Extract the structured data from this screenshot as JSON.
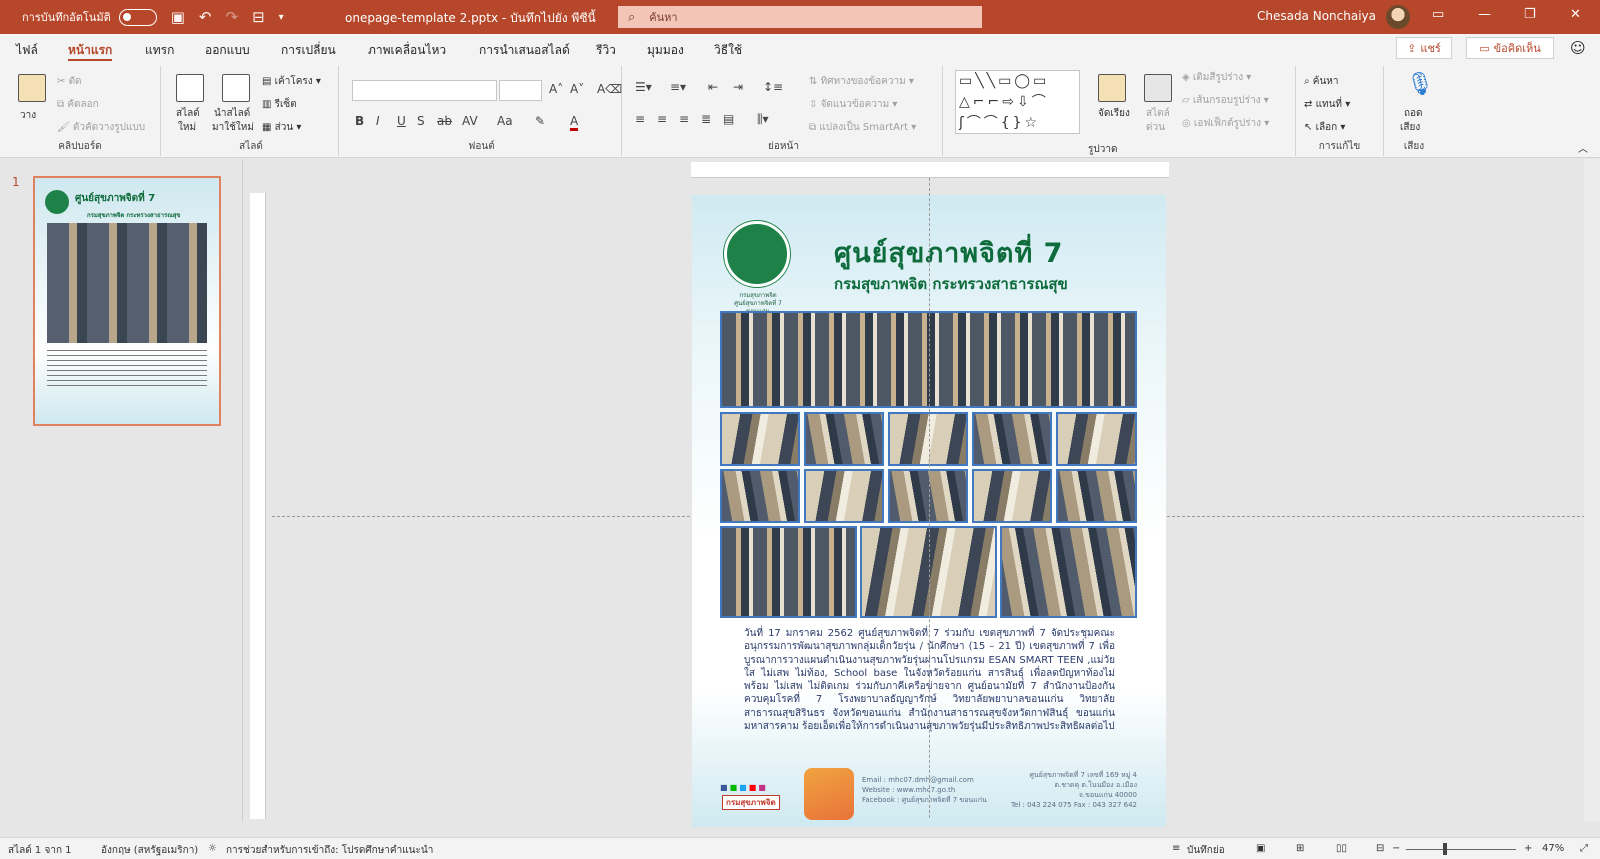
{
  "window": {
    "autosave_label": "การบันทึกอัตโนมัติ",
    "title": "onepage-template 2.pptx  -  บันทึกไปยัง พีซีนี้",
    "search_placeholder": "ค้นหา",
    "user_name": "Chesada Nonchaiya"
  },
  "menu": {
    "tabs": [
      "ไฟล์",
      "หน้าแรก",
      "แทรก",
      "ออกแบบ",
      "การเปลี่ยน",
      "ภาพเคลื่อนไหว",
      "การนำเสนอสไลด์",
      "รีวิว",
      "มุมมอง",
      "วิธีใช้"
    ],
    "share": "แชร์",
    "comments": "ข้อคิดเห็น"
  },
  "ribbon": {
    "clipboard": {
      "paste": "วาง",
      "cut": "ตัด",
      "copy": "คัดลอก",
      "format_painter": "ตัวคัดวางรูปแบบ",
      "label": "คลิปบอร์ด"
    },
    "slides": {
      "new_slide_1": "สไลด์",
      "new_slide_2": "ใหม่",
      "reuse_1": "นำสไลด์",
      "reuse_2": "มาใช้ใหม่",
      "layout": "เค้าโครง",
      "reset": "รีเซ็ต",
      "section": "ส่วน",
      "label": "สไลด์"
    },
    "font": {
      "label": "ฟอนต์"
    },
    "paragraph": {
      "text_direction": "ทิศทางของข้อความ",
      "align_text": "จัดแนวข้อความ",
      "smartart": "แปลงเป็น SmartArt",
      "label": "ย่อหน้า"
    },
    "drawing": {
      "arrange": "จัดเรียง",
      "quick_styles_1": "สไตล์",
      "quick_styles_2": "ด่วน",
      "shape_fill": "เติมสีรูปร่าง",
      "shape_outline": "เส้นกรอบรูปร่าง",
      "shape_effects": "เอฟเฟ็กต์รูปร่าง",
      "label": "รูปวาด"
    },
    "editing": {
      "find": "ค้นหา",
      "replace": "แทนที่",
      "select": "เลือก",
      "label": "การแก้ไข"
    },
    "voice": {
      "dictate_1": "ถอด",
      "dictate_2": "เสียง",
      "label": "เสียง"
    }
  },
  "thumbnail": {
    "number": "1",
    "title": "ศูนย์สุขภาพจิตที่ 7",
    "subtitle": "กรมสุขภาพจิต กระทรวงสาธารณสุข"
  },
  "slide": {
    "logo_caption_1": "กรมสุขภาพจิต",
    "logo_caption_2": "ศูนย์สุขภาพจิตที่ 7 ขอนแก่น",
    "title": "ศูนย์สุขภาพจิตที่ 7",
    "subtitle": "กรมสุขภาพจิต กระทรวงสาธารณสุข",
    "body": "วันที่ 17 มกราคม 2562 ศูนย์สุขภาพจิตที่ 7 ร่วมกับ เขตสุขภาพที่ 7 จัดประชุมคณะอนุกรรมการพัฒนาสุขภาพกลุ่มเด็กวัยรุ่น / นักศึกษา (15 – 21 ปี) เขตสุขภาพที่ 7 เพื่อบูรณาการวางแผนดำเนินงานสุขภาพวัยรุ่นผ่านโปรแกรม ESAN SMART TEEN ,แม่วัยใส ไม่เสพ ไม่ท้อง, School base ในจังหวัดร้อยแก่น สารสินธุ์ เพื่อลดปัญหาท้องไม่พร้อม ไม่เสพ ไม่ติดเกม ร่วมกับภาคีเครือข่ายจาก ศูนย์อนามัยที่ 7 สำนักงานป้องกันควบคุมโรคที่ 7 โรงพยาบาลธัญญารักษ์ วิทยาลัยพยาบาลขอนแก่น วิทยาลัยสาธารณสุขสิรินธร จังหวัดขอนแก่น สำนักงานสาธารณสุขจังหวัดกาฬสินธุ์ ขอนแก่น มหาสารคาม ร้อยเอ็ดเพื่อให้การดำเนินงานสุขภาพวัยรุ่นมีประสิทธิภาพประสิทธิผลต่อไป",
    "brand": "กรมสุขภาพจิต",
    "email": "Email : mhc07.dmh@gmail.com",
    "website": "Website : www.mhc7.go.th",
    "facebook": "Facebook : ศูนย์สุขภาพจิตที่ 7 ขอนแก่น",
    "address_1": "ศูนย์สุขภาพจิตที่ 7 เลขที่ 169 หมู่ 4",
    "address_2": "ต.ชาดคุ ต.โนนมือง อ.เมือง",
    "address_3": "จ.ขอนแก่น 40000",
    "phone": "Tel : 043 224 075 Fax : 043 327 642"
  },
  "status": {
    "slide_counter": "สไลด์ 1 จาก 1",
    "language": "อังกฤษ (สหรัฐอเมริกา)",
    "accessibility": "การช่วยสำหรับการเข้าถึง: โปรดศึกษาคำแนะนำ",
    "notes": "บันทึกย่อ",
    "zoom": "47%"
  }
}
